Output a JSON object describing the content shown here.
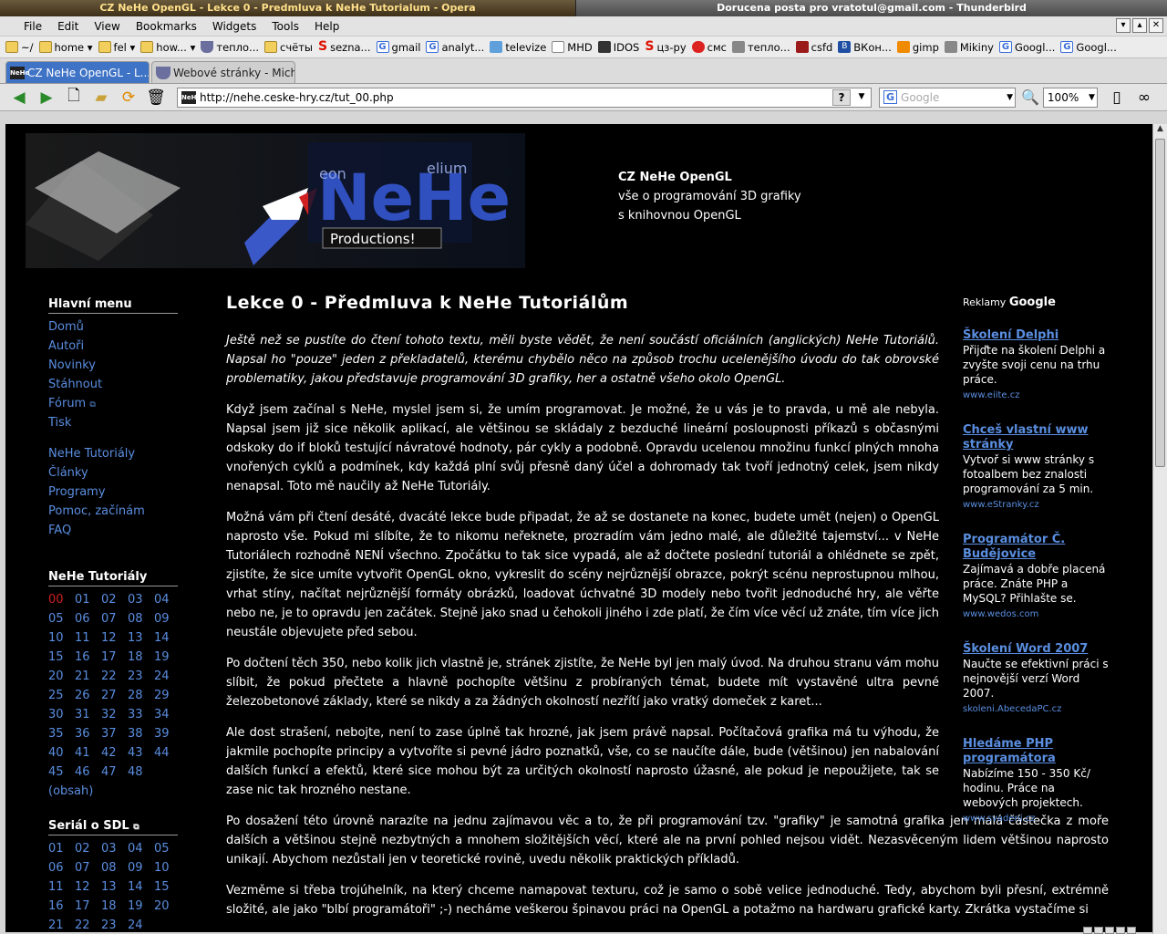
{
  "titlebar": {
    "left": "CZ NeHe OpenGL - Lekce 0 - Predmluva k NeHe Tutorialum - Opera",
    "right": "Dorucena posta pro vratotul@gmail.com - Thunderbird"
  },
  "menu": [
    "File",
    "Edit",
    "View",
    "Bookmarks",
    "Widgets",
    "Tools",
    "Help"
  ],
  "bookmarks": [
    {
      "label": "~/",
      "icon": "folder"
    },
    {
      "label": "home ▾",
      "icon": "folder"
    },
    {
      "label": "fel ▾",
      "icon": "folder"
    },
    {
      "label": "how... ▾",
      "icon": "folder"
    },
    {
      "label": "тепло...",
      "icon": "shield"
    },
    {
      "label": "счёты",
      "icon": "folder"
    },
    {
      "label": "sezna...",
      "icon": "s"
    },
    {
      "label": "gmail",
      "icon": "g"
    },
    {
      "label": "analyt...",
      "icon": "g"
    },
    {
      "label": "televize",
      "icon": "tv"
    },
    {
      "label": "MHD",
      "icon": "page"
    },
    {
      "label": "IDOS",
      "icon": "dark"
    },
    {
      "label": "цз-ру",
      "icon": "s"
    },
    {
      "label": "смс",
      "icon": "red"
    },
    {
      "label": "тепло...",
      "icon": "gray"
    },
    {
      "label": "csfd",
      "icon": "grid"
    },
    {
      "label": "ВКон...",
      "icon": "blue"
    },
    {
      "label": "gimp",
      "icon": "orange"
    },
    {
      "label": "Mikiny",
      "icon": "gray"
    },
    {
      "label": "Googl...",
      "icon": "g"
    },
    {
      "label": "Googl...",
      "icon": "g"
    }
  ],
  "tabs": [
    {
      "label": "CZ NeHe OpenGL - L...",
      "active": true
    },
    {
      "label": "Webové stránky - Mich...",
      "active": false
    }
  ],
  "toolbar": {
    "url": "http://nehe.ceske-hry.cz/tut_00.php",
    "search_placeholder": "Google",
    "zoom": "100%"
  },
  "site": {
    "logo_text": "NeHe Productions!",
    "head_title": "CZ NeHe OpenGL",
    "head_line1": "vše o programování 3D grafiky",
    "head_line2": "s knihovnou OpenGL"
  },
  "nav": {
    "main_heading": "Hlavní menu",
    "main_items": [
      "Domů",
      "Autoři",
      "Novinky",
      "Stáhnout",
      "Fórum",
      "Tisk"
    ],
    "sec_items": [
      "NeHe Tutoriály",
      "Články",
      "Programy",
      "Pomoc, začínám",
      "FAQ"
    ],
    "tut_heading": "NeHe Tutoriály",
    "tut_numbers": [
      "00",
      "01",
      "02",
      "03",
      "04",
      "05",
      "06",
      "07",
      "08",
      "09",
      "10",
      "11",
      "12",
      "13",
      "14",
      "15",
      "16",
      "17",
      "18",
      "19",
      "20",
      "21",
      "22",
      "23",
      "24",
      "25",
      "26",
      "27",
      "28",
      "29",
      "30",
      "31",
      "32",
      "33",
      "34",
      "35",
      "36",
      "37",
      "38",
      "39",
      "40",
      "41",
      "42",
      "43",
      "44",
      "45",
      "46",
      "47",
      "48"
    ],
    "tut_current": "00",
    "obsah": "(obsah)",
    "sdl_heading": "Seriál o SDL",
    "sdl_numbers": [
      "01",
      "02",
      "03",
      "04",
      "05",
      "06",
      "07",
      "08",
      "09",
      "10",
      "11",
      "12",
      "13",
      "14",
      "15",
      "16",
      "17",
      "18",
      "19",
      "20",
      "21",
      "22",
      "23",
      "24"
    ]
  },
  "main": {
    "title": "Lekce 0 - Předmluva k NeHe Tutoriálům",
    "paragraphs": [
      "Ještě než se pustíte do čtení tohoto textu, měli byste vědět, že není součástí oficiálních (anglických) NeHe Tutoriálů. Napsal ho \"pouze\" jeden z překladatelů, kterému chybělo něco na způsob trochu ucelenějšího úvodu do tak obrovské problematiky, jakou představuje programování 3D grafiky, her a ostatně všeho okolo OpenGL.",
      "Když jsem začínal s NeHe, myslel jsem si, že umím programovat. Je možné, že u vás je to pravda, u mě ale nebyla. Napsal jsem již sice několik aplikací, ale většinou se skládaly z bezduché lineární posloupnosti příkazů s občasnými odskoky do if bloků testující návratové hodnoty, pár cykly a podobně. Opravdu ucelenou množinu funkcí plných mnoha vnořených cyklů a podmínek, kdy každá plní svůj přesně daný účel a dohromady tak tvoří jednotný celek, jsem nikdy nenapsal. Toto mě naučily až NeHe Tutoriály.",
      "Možná vám při čtení desáté, dvacáté lekce bude připadat, že až se dostanete na konec, budete umět (nejen) o OpenGL naprosto vše. Pokud mi slíbíte, že to nikomu neřeknete, prozradím vám jedno malé, ale důležité tajemství... v NeHe Tutoriálech rozhodně NENÍ všechno. Zpočátku to tak sice vypadá, ale až dočtete poslední tutoriál a ohlédnete se zpět, zjistíte, že sice umíte vytvořit OpenGL okno, vykreslit do scény nejrůznější obrazce, pokrýt scénu neprostupnou mlhou, vrhat stíny, načítat nejrůznější formáty obrázků, loadovat úchvatné 3D modely nebo tvořit jednoduché hry, ale věřte nebo ne, je to opravdu jen začátek. Stejně jako snad u čehokoli jiného i zde platí, že čím více věcí už znáte, tím více jich neustále objevujete před sebou.",
      "Po dočtení těch 350, nebo kolik jich vlastně je, stránek zjistíte, že NeHe byl jen malý úvod. Na druhou stranu vám mohu slíbit, že pokud přečtete a hlavně pochopíte většinu z probíraných témat, budete mít vystavěné ultra pevné železobetonové základy, které se nikdy a za žádných okolností nezřítí jako vratký domeček z karet...",
      "Ale dost strašení, nebojte, není to zase úplně tak hrozné, jak jsem právě napsal. Počítačová grafika má tu výhodu, že jakmile pochopíte principy a vytvoříte si pevné jádro poznatků, vše, co se naučíte dále, bude (většinou) jen nabalování dalších funkcí a efektů, které sice mohou být za určitých okolností naprosto úžasné, ale pokud je nepoužijete, tak se zase nic tak hrozného nestane.",
      "Po dosažení této úrovně narazíte na jednu zajímavou věc a to, že při programování tzv. \"grafiky\" je samotná grafika jen malá částečka z moře dalších a většinou stejně nezbytných a mnohem složitějších věcí, které ale na první pohled nejsou vidět. Nezasvěceným lidem většinou naprosto unikají. Abychom nezůstali jen v teoretické rovině, uvedu několik praktických příkladů.",
      "Vezměme si třeba trojúhelník, na který chceme namapovat texturu, což je samo o sobě velice jednoduché. Tedy, abychom byli přesní, extrémně složité, ale jako \"blbí programátoři\" ;-) necháme veškerou špinavou práci na OpenGL a potažmo na hardwaru grafické karty. Zkrátka vystačíme si"
    ]
  },
  "ads": {
    "header_prefix": "Reklamy",
    "header_brand": "Google",
    "items": [
      {
        "title": "Školení Delphi",
        "body": "Přijďte na školení Delphi a zvyšte svoji cenu na trhu práce.",
        "url": "www.eiite.cz"
      },
      {
        "title": "Chceš vlastní www stránky",
        "body": "Vytvoř si www stránky s fotoalbem bez znalosti programování za 5 min.",
        "url": "www.eStranky.cz"
      },
      {
        "title": "Programátor Č. Budějovice",
        "body": "Zajímavá a dobře placená práce. Znáte PHP a MySQL? Přihlašte se.",
        "url": "www.wedos.com"
      },
      {
        "title": "Školení Word 2007",
        "body": "Naučte se efektivní práci s nejnovější verzí Word 2007.",
        "url": "skoleni.AbecedaPC.cz"
      },
      {
        "title": "Hledáme PHP programátora",
        "body": "Nabízíme 150 - 350 Kč/ hodinu. Práce na webových projektech.",
        "url": "www.svadeni.cz"
      }
    ]
  }
}
